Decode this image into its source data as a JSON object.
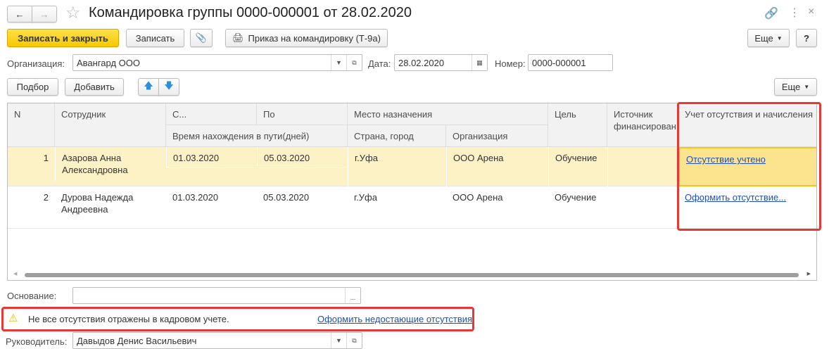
{
  "header": {
    "title": "Командировка группы 0000-000001 от 28.02.2020"
  },
  "toolbar": {
    "save_close": "Записать и закрыть",
    "save": "Записать",
    "print": "Приказ на командировку (Т-9а)",
    "more": "Еще",
    "help": "?"
  },
  "form": {
    "org_label": "Организация:",
    "org_value": "Авангард ООО",
    "date_label": "Дата:",
    "date_value": "28.02.2020",
    "number_label": "Номер:",
    "number_value": "0000-000001"
  },
  "table_toolbar": {
    "select": "Подбор",
    "add": "Добавить",
    "more": "Еще"
  },
  "table": {
    "headers": {
      "n": "N",
      "employee": "Сотрудник",
      "from": "С...",
      "to": "По",
      "travel": "Время нахождения в пути(дней)",
      "place": "Место назначения",
      "city": "Страна, город",
      "org": "Организация",
      "goal": "Цель",
      "source": "Источник финансирован",
      "absence": "Учет отсутствия и начисления"
    },
    "rows": [
      {
        "n": "1",
        "employee": "Азарова Анна Александровна",
        "from": "01.03.2020",
        "to": "05.03.2020",
        "city": "г.Уфа",
        "org": "ООО Арена",
        "goal": "Обучение",
        "source": "",
        "absence": "Отсутствие учтено"
      },
      {
        "n": "2",
        "employee": "Дурова Надежда Андреевна",
        "from": "01.03.2020",
        "to": "05.03.2020",
        "city": "г.Уфа",
        "org": "ООО Арена",
        "goal": "Обучение",
        "source": "",
        "absence": "Оформить отсутствие..."
      }
    ]
  },
  "basis": {
    "label": "Основание:",
    "value": "",
    "button": "..."
  },
  "warning": {
    "text": "Не все отсутствия отражены в кадровом учете.",
    "link": "Оформить недостающие отсутствия"
  },
  "manager": {
    "label": "Руководитель:",
    "value": "Давыдов Денис Васильевич"
  }
}
